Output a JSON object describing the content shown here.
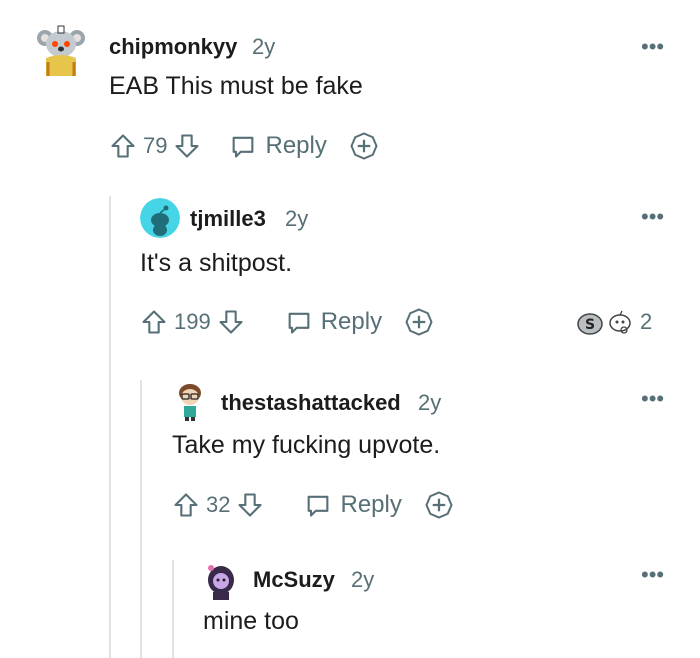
{
  "comments": [
    {
      "author": "chipmonkyy",
      "age": "2y",
      "body": "EAB This must be fake",
      "score": "79",
      "reply_label": "Reply"
    },
    {
      "author": "tjmille3",
      "age": "2y",
      "body": "It's a shitpost.",
      "score": "199",
      "reply_label": "Reply",
      "award_count": "2"
    },
    {
      "author": "thestashattacked",
      "age": "2y",
      "body": "Take my fucking upvote.",
      "score": "32",
      "reply_label": "Reply"
    },
    {
      "author": "McSuzy",
      "age": "2y",
      "body": "mine too"
    }
  ],
  "more_label": "•••",
  "colors": {
    "text": "#1c1c1c",
    "muted": "#576f76",
    "thread_line": "#dfe3e6",
    "avatar_teal": "#46d5e6"
  }
}
